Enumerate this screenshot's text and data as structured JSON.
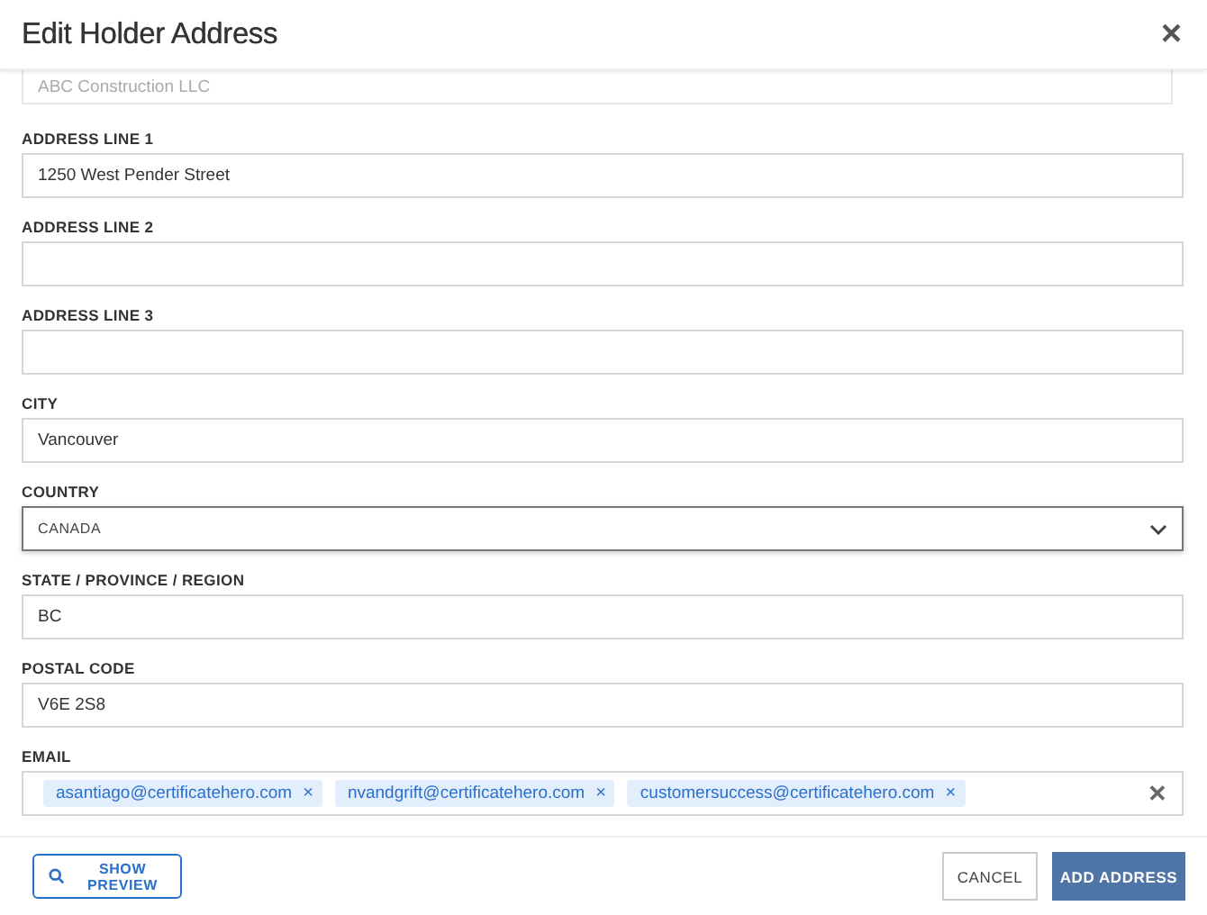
{
  "dialog": {
    "title": "Edit Holder Address",
    "close": "×"
  },
  "fields": [
    {
      "kind": "text",
      "value": "ABC Construction LLC",
      "disabled": true,
      "clipped": true
    },
    {
      "kind": "text",
      "label": "ADDRESS LINE 1",
      "value": "1250 West Pender Street",
      "disabled": false
    },
    {
      "kind": "text",
      "label": "ADDRESS LINE 2",
      "disabled": false
    },
    {
      "kind": "text",
      "label": "ADDRESS LINE 3",
      "disabled": false
    },
    {
      "kind": "text",
      "label": "CITY",
      "value": "Vancouver",
      "disabled": false
    },
    {
      "kind": "select",
      "label": "COUNTRY",
      "value": "CANADA",
      "focused": true
    },
    {
      "kind": "text",
      "label": "STATE / PROVINCE / REGION",
      "value": "BC",
      "disabled": false
    },
    {
      "kind": "text",
      "label": "POSTAL CODE",
      "value": "V6E 2S8",
      "disabled": false
    },
    {
      "kind": "tags",
      "label": "EMAIL",
      "tags": [
        "asantiago@certificatehero.com",
        "nvandgrift@certificatehero.com",
        "customersuccess@certificatehero.com"
      ],
      "tag_remove": "×",
      "clear": "✕"
    }
  ],
  "footer": {
    "preview": {
      "line1": "SHOW",
      "line2": "PREVIEW"
    },
    "cancel": "CANCEL",
    "submit": "ADD ADDRESS"
  }
}
